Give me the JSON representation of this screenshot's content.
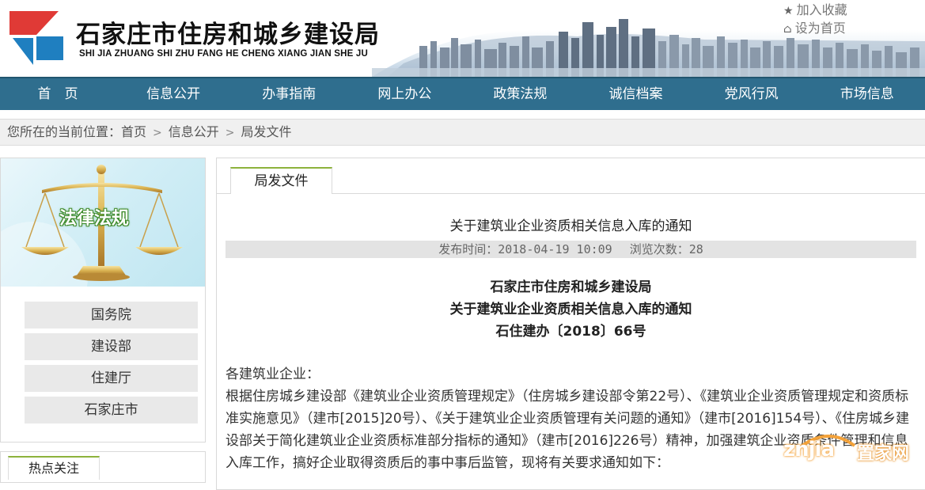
{
  "header": {
    "title": "石家庄市住房和城乡建设局",
    "pinyin": "SHI JIA ZHUANG SHI ZHU FANG HE CHENG XIANG JIAN SHE JU",
    "top_links": [
      {
        "icon": "star-icon",
        "label": "加入收藏"
      },
      {
        "icon": "home-icon",
        "label": "设为首页"
      }
    ],
    "colors": {
      "logo_red": "#e03a36",
      "logo_blue": "#1f7fc0"
    }
  },
  "nav": {
    "items": [
      "首　页",
      "信息公开",
      "办事指南",
      "网上办公",
      "政策法规",
      "诚信档案",
      "党风行风",
      "市场信息"
    ],
    "background": "#2f6e8e"
  },
  "breadcrumb": {
    "prefix": "您所在的当前位置：",
    "items": [
      "首页",
      "信息公开",
      "局发文件"
    ]
  },
  "sidebar": {
    "banner_text": "法律法规",
    "links": [
      "国务院",
      "建设部",
      "住建厅",
      "石家庄市"
    ],
    "hot_title": "热点关注"
  },
  "main": {
    "tab_label": "局发文件",
    "article_title": "关于建筑业企业资质相关信息入库的通知",
    "publish_label": "发布时间：",
    "publish_time": "2018-04-19 10:09",
    "views_label": "浏览次数：",
    "views": "28",
    "head_lines": [
      "石家庄市住房和城乡建设局",
      "关于建筑业企业资质相关信息入库的通知",
      "石住建办〔2018〕66号"
    ],
    "salutation": "各建筑业企业：",
    "paragraph": "根据住房城乡建设部《建筑业企业资质管理规定》（住房城乡建设部令第22号）、《建筑业企业资质管理规定和资质标准实施意见》（建市[2015]20号）、《关于建筑业企业资质管理有关问题的通知》（建市[2016]154号）、《住房城乡建设部关于简化建筑业企业资质标准部分指标的通知》（建市[2016]226号）精神，加强建筑企业资质条件管理和信息入库工作，搞好企业取得资质后的事中事后监管，现将有关要求通知如下："
  },
  "watermark": {
    "latin": "znjia",
    "chinese": "置家网"
  },
  "accent_color": "#8db23c"
}
